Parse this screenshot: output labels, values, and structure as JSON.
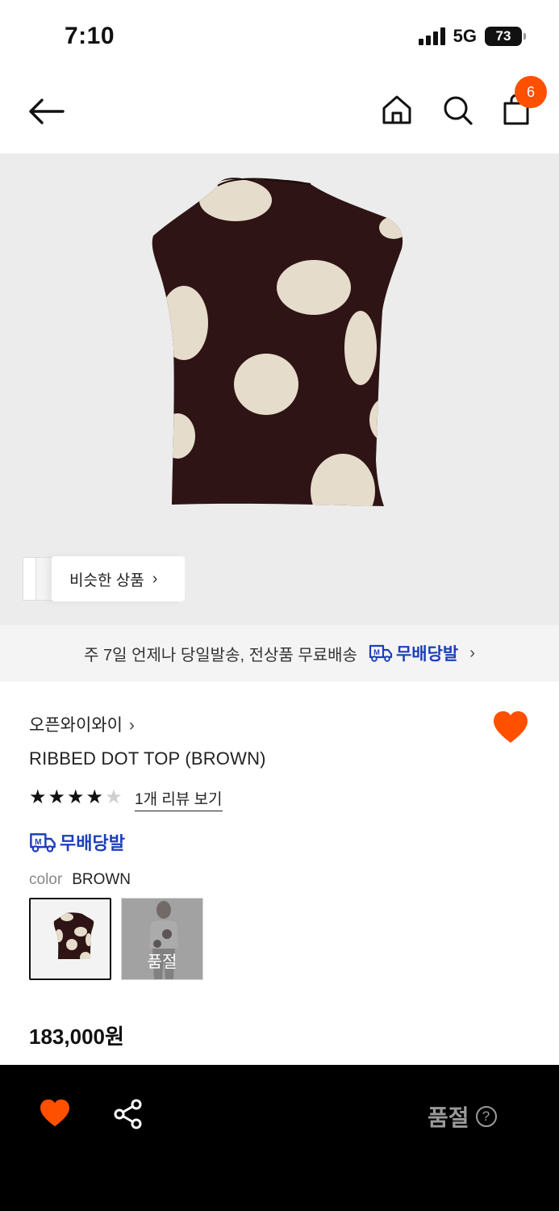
{
  "status_bar": {
    "time": "7:10",
    "network": "5G",
    "battery": "73"
  },
  "nav": {
    "icons": [
      "arrow-left-icon",
      "home-icon",
      "search-icon",
      "shopping-bag-icon"
    ],
    "cart_count": "6"
  },
  "hero": {
    "similar_label": "비슷한 상품",
    "chevron": "›"
  },
  "banner": {
    "text": "주 7일 언제나 당일발송, 전상품 무료배송",
    "badge_label": "무배당발",
    "chevron": "›"
  },
  "product": {
    "brand": "오픈와이와이",
    "brand_chevron": "›",
    "title": "RIBBED DOT TOP (BROWN)",
    "rating": 4,
    "rating_max": 5,
    "review_link": "1개 리뷰 보기",
    "badge_label": "무배당발",
    "color_key": "color",
    "color_value": "BROWN",
    "swatch_soldout_label": "품절",
    "price": "183,000원"
  },
  "bottom_bar": {
    "soldout_label": "품절",
    "help_glyph": "?"
  },
  "colors": {
    "accent": "#ff5000",
    "badge_blue": "#1d3fbb",
    "sweater_brown": "#2e1414",
    "dot_cream": "#e6dccb"
  }
}
